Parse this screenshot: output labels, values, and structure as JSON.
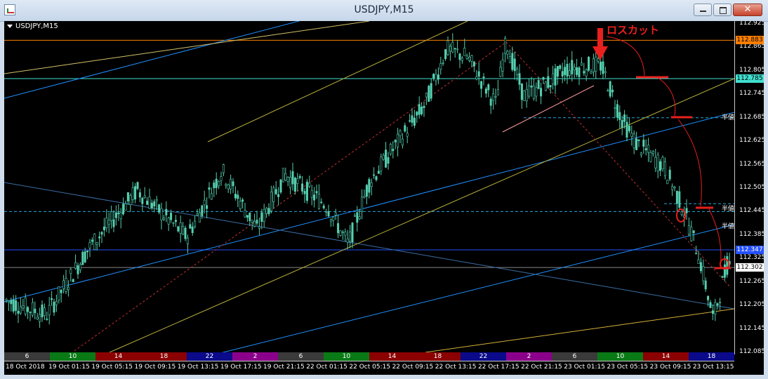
{
  "window": {
    "title": "USDJPY,M15"
  },
  "chart": {
    "symbol_label": "USDJPY,M15",
    "annotation": "ロスカット",
    "half_tags": [
      "半値",
      "半値",
      "半値"
    ],
    "price_ticks": [
      "112.925",
      "112.865",
      "112.805",
      "112.745",
      "112.685",
      "112.625",
      "112.565",
      "112.505",
      "112.445",
      "112.385",
      "112.325",
      "112.265",
      "112.205",
      "112.145",
      "112.085"
    ],
    "price_badges": [
      {
        "text": "112.883",
        "bg": "#ff7f00",
        "fg": "#000000",
        "price": 112.883
      },
      {
        "text": "112.785",
        "bg": "#40e0d0",
        "fg": "#000000",
        "price": 112.785
      },
      {
        "text": "112.347",
        "bg": "#2550ff",
        "fg": "#ffffff",
        "price": 112.347
      },
      {
        "text": "112.302",
        "bg": "#ffffff",
        "fg": "#000000",
        "price": 112.302
      }
    ],
    "time_ticks": [
      "18 Oct 2018",
      "19 Oct 01:15",
      "19 Oct 05:15",
      "19 Oct 09:15",
      "19 Oct 13:15",
      "19 Oct 17:15",
      "19 Oct 21:15",
      "22 Oct 01:15",
      "22 Oct 05:15",
      "22 Oct 09:15",
      "22 Oct 13:15",
      "22 Oct 17:15",
      "22 Oct 21:15",
      "23 Oct 01:15",
      "23 Oct 05:15",
      "23 Oct 09:15",
      "23 Oct 13:15"
    ],
    "session_hours": [
      "6",
      "10",
      "14",
      "18",
      "22",
      "2",
      "6",
      "10",
      "14",
      "18",
      "22",
      "2",
      "6",
      "10",
      "14",
      "18"
    ],
    "session_colors": [
      "#3a3a3a",
      "#0a7a16",
      "#8b0000",
      "#8b0000",
      "#0a0a8a",
      "#8b008b",
      "#3a3a3a",
      "#0a7a16",
      "#8b0000",
      "#8b0000",
      "#0a0a8a",
      "#8b008b",
      "#3a3a3a",
      "#0a7a16",
      "#8b0000",
      "#0a0a8a"
    ],
    "colors": {
      "candle": "#55d0b0",
      "background": "#000000",
      "annotation": "#e8201e"
    }
  }
}
